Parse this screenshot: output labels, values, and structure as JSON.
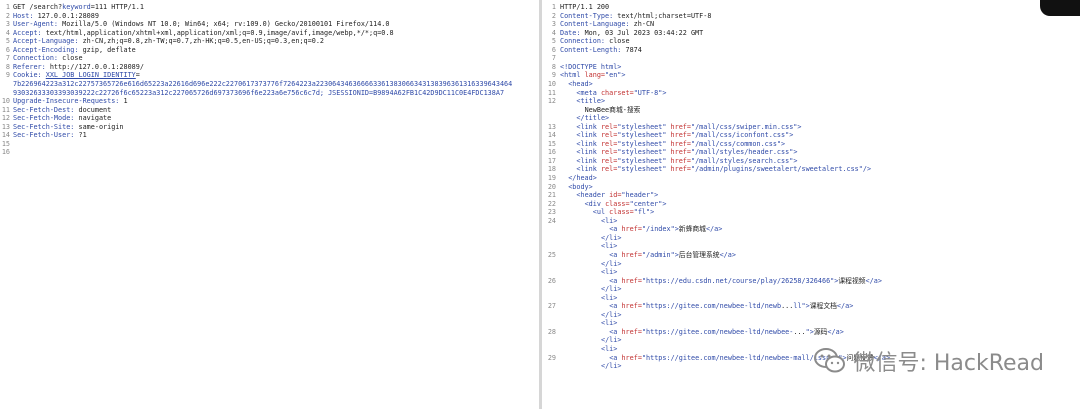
{
  "request": {
    "lines": [
      {
        "n": "1",
        "parts": [
          {
            "t": "GET /search?",
            "c": ""
          },
          {
            "t": "keyword",
            "c": "tagc"
          },
          {
            "t": "=111 HTTP/1.1",
            "c": ""
          }
        ]
      },
      {
        "n": "2",
        "parts": [
          {
            "t": "Host: ",
            "c": "tagc"
          },
          {
            "t": "127.0.0.1:28089",
            "c": ""
          }
        ]
      },
      {
        "n": "3",
        "parts": [
          {
            "t": "User-Agent: ",
            "c": "tagc"
          },
          {
            "t": "Mozilla/5.0 (Windows NT 10.0; Win64; x64; rv:109.0) Gecko/20100101 Firefox/114.0",
            "c": ""
          }
        ]
      },
      {
        "n": "4",
        "parts": [
          {
            "t": "Accept: ",
            "c": "tagc"
          },
          {
            "t": "text/html,application/xhtml+xml,application/xml;q=0.9,image/avif,image/webp,*/*;q=0.8",
            "c": ""
          }
        ]
      },
      {
        "n": "5",
        "parts": [
          {
            "t": "Accept-Language: ",
            "c": "tagc"
          },
          {
            "t": "zh-CN,zh;q=0.8,zh-TW;q=0.7,zh-HK;q=0.5,en-US;q=0.3,en;q=0.2",
            "c": ""
          }
        ]
      },
      {
        "n": "6",
        "parts": [
          {
            "t": "Accept-Encoding: ",
            "c": "tagc"
          },
          {
            "t": "gzip, deflate",
            "c": ""
          }
        ]
      },
      {
        "n": "7",
        "parts": [
          {
            "t": "Connection: ",
            "c": "tagc"
          },
          {
            "t": "close",
            "c": ""
          }
        ]
      },
      {
        "n": "8",
        "parts": [
          {
            "t": "Referer: ",
            "c": "tagc"
          },
          {
            "t": "http://127.0.0.1:28089/",
            "c": ""
          }
        ]
      },
      {
        "n": "9",
        "parts": [
          {
            "t": "Cookie: ",
            "c": "tagc"
          },
          {
            "t": "XXL_JOB_LOGIN_IDENTITY",
            "c": "underline"
          },
          {
            "t": "=",
            "c": ""
          }
        ]
      },
      {
        "n": "",
        "parts": [
          {
            "t": "7b226964223a312c22757365726e616d65223a22616d696e222c2270617373776f7264223a223064346366663361383066343138396361316339643464",
            "c": "tagc"
          }
        ]
      },
      {
        "n": "",
        "parts": [
          {
            "t": "93032633303393039222c22726f6c65223a312c227065726d697373696f6e223a6e756c6c7d; ",
            "c": "tagc"
          },
          {
            "t": "JSESSIONID",
            "c": "tagc"
          },
          {
            "t": "=B9894A62FB1C42D9DC11C0E4FDC138A7",
            "c": "tagc"
          }
        ]
      },
      {
        "n": "10",
        "parts": [
          {
            "t": "Upgrade-Insecure-Requests: ",
            "c": "tagc"
          },
          {
            "t": "1",
            "c": ""
          }
        ]
      },
      {
        "n": "11",
        "parts": [
          {
            "t": "Sec-Fetch-Dest: ",
            "c": "tagc"
          },
          {
            "t": "document",
            "c": ""
          }
        ]
      },
      {
        "n": "12",
        "parts": [
          {
            "t": "Sec-Fetch-Mode: ",
            "c": "tagc"
          },
          {
            "t": "navigate",
            "c": ""
          }
        ]
      },
      {
        "n": "13",
        "parts": [
          {
            "t": "Sec-Fetch-Site: ",
            "c": "tagc"
          },
          {
            "t": "same-origin",
            "c": ""
          }
        ]
      },
      {
        "n": "14",
        "parts": [
          {
            "t": "Sec-Fetch-User: ",
            "c": "tagc"
          },
          {
            "t": "?1",
            "c": ""
          }
        ]
      },
      {
        "n": "15",
        "parts": []
      },
      {
        "n": "16",
        "parts": []
      }
    ]
  },
  "response": {
    "lines": [
      {
        "n": "1",
        "i": 0,
        "parts": [
          {
            "t": "HTTP/1.1 200",
            "c": ""
          }
        ]
      },
      {
        "n": "2",
        "i": 0,
        "parts": [
          {
            "t": "Content-Type: ",
            "c": "tagc"
          },
          {
            "t": "text/html;charset=UTF-8",
            "c": ""
          }
        ]
      },
      {
        "n": "3",
        "i": 0,
        "parts": [
          {
            "t": "Content-Language: ",
            "c": "tagc"
          },
          {
            "t": "zh-CN",
            "c": ""
          }
        ]
      },
      {
        "n": "4",
        "i": 0,
        "parts": [
          {
            "t": "Date: ",
            "c": "tagc"
          },
          {
            "t": "Mon, 03 Jul 2023 03:44:22 GMT",
            "c": ""
          }
        ]
      },
      {
        "n": "5",
        "i": 0,
        "parts": [
          {
            "t": "Connection: ",
            "c": "tagc"
          },
          {
            "t": "close",
            "c": ""
          }
        ]
      },
      {
        "n": "6",
        "i": 0,
        "parts": [
          {
            "t": "Content-Length: ",
            "c": "tagc"
          },
          {
            "t": "7874",
            "c": ""
          }
        ]
      },
      {
        "n": "7",
        "i": 0,
        "parts": []
      },
      {
        "n": "8",
        "i": 0,
        "parts": [
          {
            "t": "<!DOCTYPE html>",
            "c": "tagc"
          }
        ]
      },
      {
        "n": "9",
        "i": 0,
        "parts": [
          {
            "t": "<html ",
            "c": "tagc"
          },
          {
            "t": "lang=",
            "c": "attrc"
          },
          {
            "t": "\"en\"",
            "c": "valc"
          },
          {
            "t": ">",
            "c": "tagc"
          }
        ]
      },
      {
        "n": "10",
        "i": 1,
        "parts": [
          {
            "t": "<head>",
            "c": "tagc"
          }
        ]
      },
      {
        "n": "11",
        "i": 2,
        "parts": [
          {
            "t": "<meta ",
            "c": "tagc"
          },
          {
            "t": "charset=",
            "c": "attrc"
          },
          {
            "t": "\"UTF-8\"",
            "c": "valc"
          },
          {
            "t": ">",
            "c": "tagc"
          }
        ]
      },
      {
        "n": "12",
        "i": 2,
        "parts": [
          {
            "t": "<title>",
            "c": "tagc"
          }
        ]
      },
      {
        "n": "",
        "i": 3,
        "parts": [
          {
            "t": "NewBee商城-搜索",
            "c": "txtc"
          }
        ]
      },
      {
        "n": "",
        "i": 2,
        "parts": [
          {
            "t": "</title>",
            "c": "tagc"
          }
        ]
      },
      {
        "n": "13",
        "i": 2,
        "parts": [
          {
            "t": "<link ",
            "c": "tagc"
          },
          {
            "t": "rel=",
            "c": "attrc"
          },
          {
            "t": "\"stylesheet\" ",
            "c": "valc"
          },
          {
            "t": "href=",
            "c": "attrc"
          },
          {
            "t": "\"/mall/css/swiper.min.css\"",
            "c": "valc"
          },
          {
            "t": ">",
            "c": "tagc"
          }
        ]
      },
      {
        "n": "14",
        "i": 2,
        "parts": [
          {
            "t": "<link ",
            "c": "tagc"
          },
          {
            "t": "rel=",
            "c": "attrc"
          },
          {
            "t": "\"stylesheet\" ",
            "c": "valc"
          },
          {
            "t": "href=",
            "c": "attrc"
          },
          {
            "t": "\"/mall/css/iconfont.css\"",
            "c": "valc"
          },
          {
            "t": ">",
            "c": "tagc"
          }
        ]
      },
      {
        "n": "15",
        "i": 2,
        "parts": [
          {
            "t": "<link ",
            "c": "tagc"
          },
          {
            "t": "rel=",
            "c": "attrc"
          },
          {
            "t": "\"stylesheet\" ",
            "c": "valc"
          },
          {
            "t": "href=",
            "c": "attrc"
          },
          {
            "t": "\"/mall/css/common.css\"",
            "c": "valc"
          },
          {
            "t": ">",
            "c": "tagc"
          }
        ]
      },
      {
        "n": "16",
        "i": 2,
        "parts": [
          {
            "t": "<link ",
            "c": "tagc"
          },
          {
            "t": "rel=",
            "c": "attrc"
          },
          {
            "t": "\"stylesheet\" ",
            "c": "valc"
          },
          {
            "t": "href=",
            "c": "attrc"
          },
          {
            "t": "\"/mall/styles/header.css\"",
            "c": "valc"
          },
          {
            "t": ">",
            "c": "tagc"
          }
        ]
      },
      {
        "n": "17",
        "i": 2,
        "parts": [
          {
            "t": "<link ",
            "c": "tagc"
          },
          {
            "t": "rel=",
            "c": "attrc"
          },
          {
            "t": "\"stylesheet\" ",
            "c": "valc"
          },
          {
            "t": "href=",
            "c": "attrc"
          },
          {
            "t": "\"/mall/styles/search.css\"",
            "c": "valc"
          },
          {
            "t": ">",
            "c": "tagc"
          }
        ]
      },
      {
        "n": "18",
        "i": 2,
        "parts": [
          {
            "t": "<link ",
            "c": "tagc"
          },
          {
            "t": "rel=",
            "c": "attrc"
          },
          {
            "t": "\"stylesheet\" ",
            "c": "valc"
          },
          {
            "t": "href=",
            "c": "attrc"
          },
          {
            "t": "\"/admin/plugins/sweetalert/sweetalert.css\"",
            "c": "valc"
          },
          {
            "t": "/>",
            "c": "tagc"
          }
        ]
      },
      {
        "n": "19",
        "i": 1,
        "parts": [
          {
            "t": "</head>",
            "c": "tagc"
          }
        ]
      },
      {
        "n": "20",
        "i": 1,
        "parts": [
          {
            "t": "<body>",
            "c": "tagc"
          }
        ]
      },
      {
        "n": "21",
        "i": 2,
        "parts": [
          {
            "t": "<header ",
            "c": "tagc"
          },
          {
            "t": "id=",
            "c": "attrc"
          },
          {
            "t": "\"header\"",
            "c": "valc"
          },
          {
            "t": ">",
            "c": "tagc"
          }
        ]
      },
      {
        "n": "22",
        "i": 3,
        "parts": [
          {
            "t": "<div ",
            "c": "tagc"
          },
          {
            "t": "class=",
            "c": "attrc"
          },
          {
            "t": "\"center\"",
            "c": "valc"
          },
          {
            "t": ">",
            "c": "tagc"
          }
        ]
      },
      {
        "n": "23",
        "i": 4,
        "parts": [
          {
            "t": "<ul ",
            "c": "tagc"
          },
          {
            "t": "class=",
            "c": "attrc"
          },
          {
            "t": "\"fl\"",
            "c": "valc"
          },
          {
            "t": ">",
            "c": "tagc"
          }
        ]
      },
      {
        "n": "24",
        "i": 5,
        "parts": [
          {
            "t": "<li>",
            "c": "tagc"
          }
        ]
      },
      {
        "n": "",
        "i": 6,
        "parts": [
          {
            "t": "<a ",
            "c": "tagc"
          },
          {
            "t": "href=",
            "c": "attrc"
          },
          {
            "t": "\"/index\"",
            "c": "valc"
          },
          {
            "t": ">",
            "c": "tagc"
          },
          {
            "t": "新蜂商城",
            "c": "txtc"
          },
          {
            "t": "</a>",
            "c": "tagc"
          }
        ]
      },
      {
        "n": "",
        "i": 5,
        "parts": [
          {
            "t": "</li>",
            "c": "tagc"
          }
        ]
      },
      {
        "n": "",
        "i": 5,
        "parts": [
          {
            "t": "<li>",
            "c": "tagc"
          }
        ]
      },
      {
        "n": "25",
        "i": 6,
        "parts": [
          {
            "t": "<a ",
            "c": "tagc"
          },
          {
            "t": "href=",
            "c": "attrc"
          },
          {
            "t": "\"/admin\"",
            "c": "valc"
          },
          {
            "t": ">",
            "c": "tagc"
          },
          {
            "t": "后台管理系统",
            "c": "txtc"
          },
          {
            "t": "</a>",
            "c": "tagc"
          }
        ]
      },
      {
        "n": "",
        "i": 5,
        "parts": [
          {
            "t": "</li>",
            "c": "tagc"
          }
        ]
      },
      {
        "n": "",
        "i": 5,
        "parts": [
          {
            "t": "<li>",
            "c": "tagc"
          }
        ]
      },
      {
        "n": "26",
        "i": 6,
        "parts": [
          {
            "t": "<a ",
            "c": "tagc"
          },
          {
            "t": "href=",
            "c": "attrc"
          },
          {
            "t": "\"https://edu.csdn.net/course/play/26258/326466\"",
            "c": "valc"
          },
          {
            "t": ">",
            "c": "tagc"
          },
          {
            "t": "课程视频",
            "c": "txtc"
          },
          {
            "t": "</a>",
            "c": "tagc"
          }
        ]
      },
      {
        "n": "",
        "i": 5,
        "parts": [
          {
            "t": "</li>",
            "c": "tagc"
          }
        ]
      },
      {
        "n": "",
        "i": 5,
        "parts": [
          {
            "t": "<li>",
            "c": "tagc"
          }
        ]
      },
      {
        "n": "27",
        "i": 6,
        "parts": [
          {
            "t": "<a ",
            "c": "tagc"
          },
          {
            "t": "href=",
            "c": "attrc"
          },
          {
            "t": "\"https://gitee.com/newbee-ltd/newb",
            "c": "valc"
          },
          {
            "t": "...",
            "c": "txtc"
          },
          {
            "t": "ll\"",
            "c": "valc"
          },
          {
            "t": ">",
            "c": "tagc"
          },
          {
            "t": "课程文档",
            "c": "txtc"
          },
          {
            "t": "</a>",
            "c": "tagc"
          }
        ]
      },
      {
        "n": "",
        "i": 5,
        "parts": [
          {
            "t": "</li>",
            "c": "tagc"
          }
        ]
      },
      {
        "n": "",
        "i": 5,
        "parts": [
          {
            "t": "<li>",
            "c": "tagc"
          }
        ]
      },
      {
        "n": "28",
        "i": 6,
        "parts": [
          {
            "t": "<a ",
            "c": "tagc"
          },
          {
            "t": "href=",
            "c": "attrc"
          },
          {
            "t": "\"https://gitee.com/newbee-ltd/newbee-",
            "c": "valc"
          },
          {
            "t": "...",
            "c": "txtc"
          },
          {
            "t": "\">",
            "c": "tagc"
          },
          {
            "t": "源码",
            "c": "txtc"
          },
          {
            "t": "</a>",
            "c": "tagc"
          }
        ]
      },
      {
        "n": "",
        "i": 5,
        "parts": [
          {
            "t": "</li>",
            "c": "tagc"
          }
        ]
      },
      {
        "n": "",
        "i": 5,
        "parts": [
          {
            "t": "<li>",
            "c": "tagc"
          }
        ]
      },
      {
        "n": "29",
        "i": 6,
        "parts": [
          {
            "t": "<a ",
            "c": "tagc"
          },
          {
            "t": "href=",
            "c": "attrc"
          },
          {
            "t": "\"https://gitee.com/newbee-ltd/newbee-mall/issues\"",
            "c": "valc"
          },
          {
            "t": ">",
            "c": "tagc"
          },
          {
            "t": "问题反馈",
            "c": "txtc"
          },
          {
            "t": "</a>",
            "c": "tagc"
          }
        ]
      },
      {
        "n": "",
        "i": 5,
        "parts": [
          {
            "t": "</li>",
            "c": "tagc"
          }
        ]
      }
    ]
  },
  "watermark": {
    "text": "微信号: HackRead",
    "icon": "wechat-icon"
  },
  "colors": {
    "keyword": "#2f4aa8",
    "attr": "#c23030",
    "gutter": "#8a8a8a"
  }
}
